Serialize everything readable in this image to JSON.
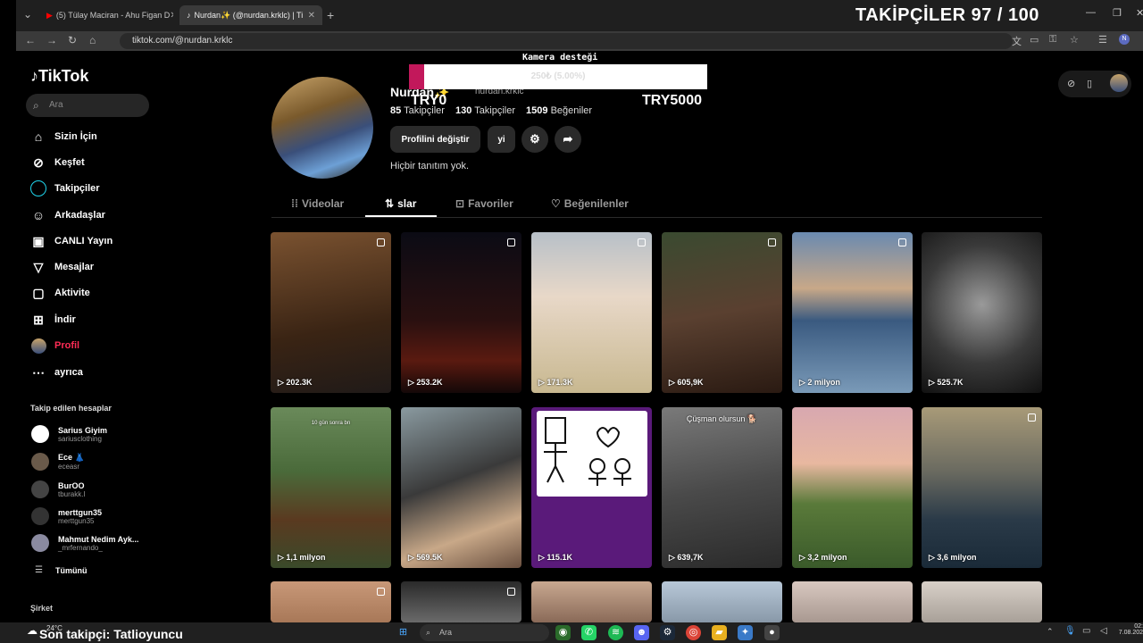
{
  "browser": {
    "tabs": [
      {
        "title": "(5) Tülay Maciran - Ahu Figan D",
        "icon": "youtube-icon"
      },
      {
        "title": "Nurdan✨ (@nurdan.krklc) | Ti",
        "icon": "tiktok-icon"
      }
    ],
    "url": "tiktok.com/@nurdan.krklc"
  },
  "overlay": {
    "title": "TAKİPÇİLER 97 / 100",
    "goal_label": "Kamera desteği",
    "goal_text": "250₺ (5.00%)",
    "goal_progress": 0.05,
    "goal_min": "TRY0",
    "goal_max": "TRY5000",
    "last_follower": "Son takipçi: Tatlioyuncu"
  },
  "sidebar": {
    "logo": "TikTok",
    "search_placeholder": "Ara",
    "nav": [
      {
        "label": "Sizin İçin",
        "icon": "home-icon"
      },
      {
        "label": "Keşfet",
        "icon": "compass-icon"
      },
      {
        "label": "Takipçiler",
        "icon": "circle-icon"
      },
      {
        "label": "Arkadaşlar",
        "icon": "friends-icon"
      },
      {
        "label": "CANLI Yayın",
        "icon": "live-icon"
      },
      {
        "label": "Mesajlar",
        "icon": "send-icon"
      },
      {
        "label": "Aktivite",
        "icon": "inbox-icon"
      },
      {
        "label": "İndir",
        "icon": "download-icon"
      },
      {
        "label": "Profil",
        "icon": "avatar-icon"
      },
      {
        "label": "ayrıca",
        "icon": "more-icon"
      }
    ],
    "following_header": "Takip edilen hesaplar",
    "accounts": [
      {
        "name": "Sarius Giyim",
        "user": "sariusclothing"
      },
      {
        "name": "Ece 👗",
        "user": "eceasr"
      },
      {
        "name": "BurOO",
        "user": "tburakk.l"
      },
      {
        "name": "merttgun35",
        "user": "merttgun35"
      },
      {
        "name": "Mahmut Nedim Ayk...",
        "user": "_mrfernando_"
      }
    ],
    "see_all": "Tümünü",
    "company": "Şirket"
  },
  "profile": {
    "name": "Nurdan✨",
    "username": "nurdan.krklc",
    "following_count": "85",
    "following_label": "Takipçiler",
    "followers_count": "130",
    "followers_label": "Takipçiler",
    "likes_count": "1509",
    "likes_label": "Beğeniler",
    "edit_button": "Profilini değiştir",
    "promote_button": "yi",
    "bio": "Hiçbir tanıtım yok."
  },
  "tabs": [
    {
      "label": "Videolar"
    },
    {
      "label": "slar"
    },
    {
      "label": "Favoriler"
    },
    {
      "label": "Beğenilenler"
    }
  ],
  "videos": [
    {
      "views": "202.3K"
    },
    {
      "views": "253.2K"
    },
    {
      "views": "171.3K"
    },
    {
      "views": "605,9K"
    },
    {
      "views": "2 milyon"
    },
    {
      "views": "525.7K"
    },
    {
      "views": "1,1 milyon",
      "caption": "10 gün sonra bn"
    },
    {
      "views": "569.5K"
    },
    {
      "views": "115.1K"
    },
    {
      "views": "639,7K",
      "caption": "Çüşman olursun 🐕"
    },
    {
      "views": "3,2 milyon"
    },
    {
      "views": "3,6 milyon"
    }
  ],
  "taskbar": {
    "weather": "24°C",
    "search": "Ara",
    "time": "02:",
    "date": "7.08.202"
  }
}
